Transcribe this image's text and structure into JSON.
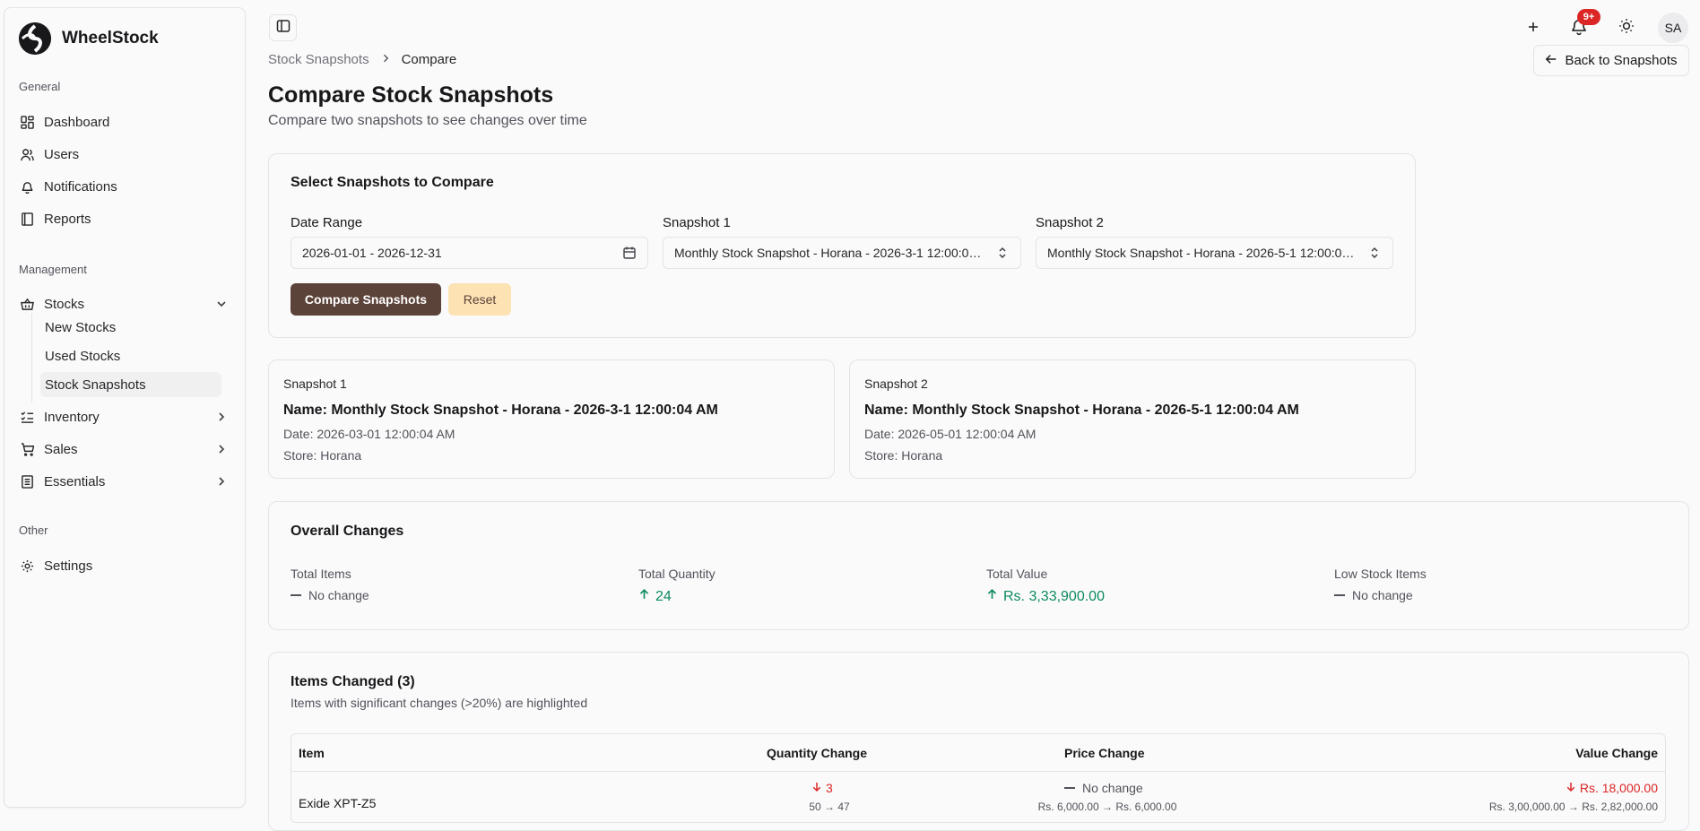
{
  "app": {
    "name": "WheelStock"
  },
  "sidebar": {
    "groups": [
      {
        "label": "General"
      },
      {
        "label": "Management"
      },
      {
        "label": "Other"
      }
    ],
    "general": [
      {
        "label": "Dashboard",
        "icon": "dashboard-icon"
      },
      {
        "label": "Users",
        "icon": "users-icon"
      },
      {
        "label": "Notifications",
        "icon": "bell-icon"
      },
      {
        "label": "Reports",
        "icon": "book-icon"
      }
    ],
    "management": {
      "stocks": {
        "label": "Stocks",
        "icon": "basket-icon",
        "children": [
          "New Stocks",
          "Used Stocks",
          "Stock Snapshots"
        ]
      },
      "inventory": {
        "label": "Inventory",
        "icon": "list-check-icon"
      },
      "sales": {
        "label": "Sales",
        "icon": "cart-icon"
      },
      "essentials": {
        "label": "Essentials",
        "icon": "notebook-icon"
      }
    },
    "other": [
      {
        "label": "Settings",
        "icon": "gear-icon"
      }
    ]
  },
  "topbar": {
    "notification_badge": "9+",
    "avatar": "SA"
  },
  "breadcrumb": {
    "parent": "Stock Snapshots",
    "current": "Compare"
  },
  "header": {
    "back_label": "Back to Snapshots",
    "title": "Compare Stock Snapshots",
    "subtitle": "Compare two snapshots to see changes over time"
  },
  "select_card": {
    "title": "Select Snapshots to Compare",
    "date_range_label": "Date Range",
    "date_range_value": "2026-01-01 - 2026-12-31",
    "snapshot1_label": "Snapshot 1",
    "snapshot1_value": "Monthly Stock Snapshot - Horana - 2026-3-1 12:00:04 AM",
    "snapshot2_label": "Snapshot 2",
    "snapshot2_value": "Monthly Stock Snapshot - Horana - 2026-5-1 12:00:04 AM",
    "compare_label": "Compare Snapshots",
    "reset_label": "Reset"
  },
  "snapshot_cards": [
    {
      "label": "Snapshot 1",
      "name": "Name: Monthly Stock Snapshot - Horana - 2026-3-1 12:00:04 AM",
      "date": "Date: 2026-03-01 12:00:04 AM",
      "store": "Store: Horana"
    },
    {
      "label": "Snapshot 2",
      "name": "Name: Monthly Stock Snapshot - Horana - 2026-5-1 12:00:04 AM",
      "date": "Date: 2026-05-01 12:00:04 AM",
      "store": "Store: Horana"
    }
  ],
  "overall": {
    "title": "Overall Changes",
    "stats": [
      {
        "label": "Total Items",
        "value": "No change"
      },
      {
        "label": "Total Quantity",
        "value": "24"
      },
      {
        "label": "Total Value",
        "value": "Rs. 3,33,900.00"
      },
      {
        "label": "Low Stock Items",
        "value": "No change"
      }
    ]
  },
  "items_changed": {
    "title": "Items Changed (3)",
    "subtitle": "Items with significant changes (>20%) are highlighted",
    "columns": [
      "Item",
      "Quantity Change",
      "Price Change",
      "Value Change"
    ],
    "rows": [
      {
        "item": "Exide XPT-Z5",
        "qty_change": "3",
        "qty_detail": "50 → 47",
        "price_change": "No change",
        "price_detail": "Rs. 6,000.00 → Rs. 6,000.00",
        "value_change": "Rs. 18,000.00",
        "value_detail": "Rs. 3,00,000.00 → Rs. 2,82,000.00"
      }
    ]
  }
}
